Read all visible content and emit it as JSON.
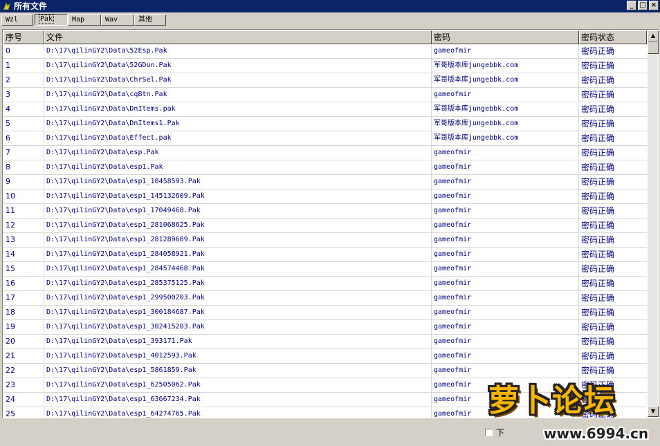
{
  "window": {
    "title": "所有文件",
    "minimize": "_",
    "maximize": "□",
    "close": "×"
  },
  "tabs": [
    {
      "label": "Wzl",
      "active": false
    },
    {
      "label": "Pak",
      "active": true
    },
    {
      "label": "Map",
      "active": false
    },
    {
      "label": "Wav",
      "active": false
    },
    {
      "label": "其他",
      "active": false
    }
  ],
  "table": {
    "columns": [
      "序号",
      "文件",
      "密码",
      "密码状态"
    ],
    "rows": [
      [
        "0",
        "D:\\17\\qilinGY2\\Data\\52Esp.Pak",
        "gameofmir",
        "密码正确"
      ],
      [
        "1",
        "D:\\17\\qilinGY2\\Data\\52GDun.Pak",
        "军哥版本库jungebbk.com",
        "密码正确"
      ],
      [
        "2",
        "D:\\17\\qilinGY2\\Data\\ChrSel.Pak",
        "军哥版本库jungebbk.com",
        "密码正确"
      ],
      [
        "3",
        "D:\\17\\qilinGY2\\Data\\cqBtn.Pak",
        "gameofmir",
        "密码正确"
      ],
      [
        "4",
        "D:\\17\\qilinGY2\\Data\\DnItems.pak",
        "军哥版本库jungebbk.com",
        "密码正确"
      ],
      [
        "5",
        "D:\\17\\qilinGY2\\Data\\DnItems1.Pak",
        "军哥版本库jungebbk.com",
        "密码正确"
      ],
      [
        "6",
        "D:\\17\\qilinGY2\\Data\\Effect.pak",
        "军哥版本库jungebbk.com",
        "密码正确"
      ],
      [
        "7",
        "D:\\17\\qilinGY2\\Data\\esp.Pak",
        "gameofmir",
        "密码正确"
      ],
      [
        "8",
        "D:\\17\\qilinGY2\\Data\\esp1.Pak",
        "gameofmir",
        "密码正确"
      ],
      [
        "9",
        "D:\\17\\qilinGY2\\Data\\esp1_10458593.Pak",
        "gameofmir",
        "密码正确"
      ],
      [
        "10",
        "D:\\17\\qilinGY2\\Data\\esp1_145132609.Pak",
        "gameofmir",
        "密码正确"
      ],
      [
        "11",
        "D:\\17\\qilinGY2\\Data\\esp1_17049468.Pak",
        "gameofmir",
        "密码正确"
      ],
      [
        "12",
        "D:\\17\\qilinGY2\\Data\\esp1_281068625.Pak",
        "gameofmir",
        "密码正确"
      ],
      [
        "13",
        "D:\\17\\qilinGY2\\Data\\esp1_281289609.Pak",
        "gameofmir",
        "密码正确"
      ],
      [
        "14",
        "D:\\17\\qilinGY2\\Data\\esp1_284058921.Pak",
        "gameofmir",
        "密码正确"
      ],
      [
        "15",
        "D:\\17\\qilinGY2\\Data\\esp1_284574468.Pak",
        "gameofmir",
        "密码正确"
      ],
      [
        "16",
        "D:\\17\\qilinGY2\\Data\\esp1_285375125.Pak",
        "gameofmir",
        "密码正确"
      ],
      [
        "17",
        "D:\\17\\qilinGY2\\Data\\esp1_299500203.Pak",
        "gameofmir",
        "密码正确"
      ],
      [
        "18",
        "D:\\17\\qilinGY2\\Data\\esp1_300184687.Pak",
        "gameofmir",
        "密码正确"
      ],
      [
        "19",
        "D:\\17\\qilinGY2\\Data\\esp1_302415203.Pak",
        "gameofmir",
        "密码正确"
      ],
      [
        "20",
        "D:\\17\\qilinGY2\\Data\\esp1_393171.Pak",
        "gameofmir",
        "密码正确"
      ],
      [
        "21",
        "D:\\17\\qilinGY2\\Data\\esp1_4012593.Pak",
        "gameofmir",
        "密码正确"
      ],
      [
        "22",
        "D:\\17\\qilinGY2\\Data\\esp1_5861859.Pak",
        "gameofmir",
        "密码正确"
      ],
      [
        "23",
        "D:\\17\\qilinGY2\\Data\\esp1_62505062.Pak",
        "gameofmir",
        "密码正确"
      ],
      [
        "24",
        "D:\\17\\qilinGY2\\Data\\esp1_63667234.Pak",
        "gameofmir",
        "密码正确"
      ],
      [
        "25",
        "D:\\17\\qilinGY2\\Data\\esp1_64274765.Pak",
        "gameofmir",
        "密码正确"
      ]
    ]
  },
  "scrollbar": {
    "up_icon": "up-arrow-icon",
    "down_icon": "down-arrow-icon",
    "up_glyph": "▲",
    "down_glyph": "▼"
  },
  "status": {
    "checkbox_label": "下"
  },
  "watermark": {
    "text": "萝卜论坛",
    "url": "www.6994.cn"
  },
  "colors": {
    "title_bar": "#0a246a",
    "row_text": "#000080",
    "window_bg": "#d4d0c8"
  }
}
